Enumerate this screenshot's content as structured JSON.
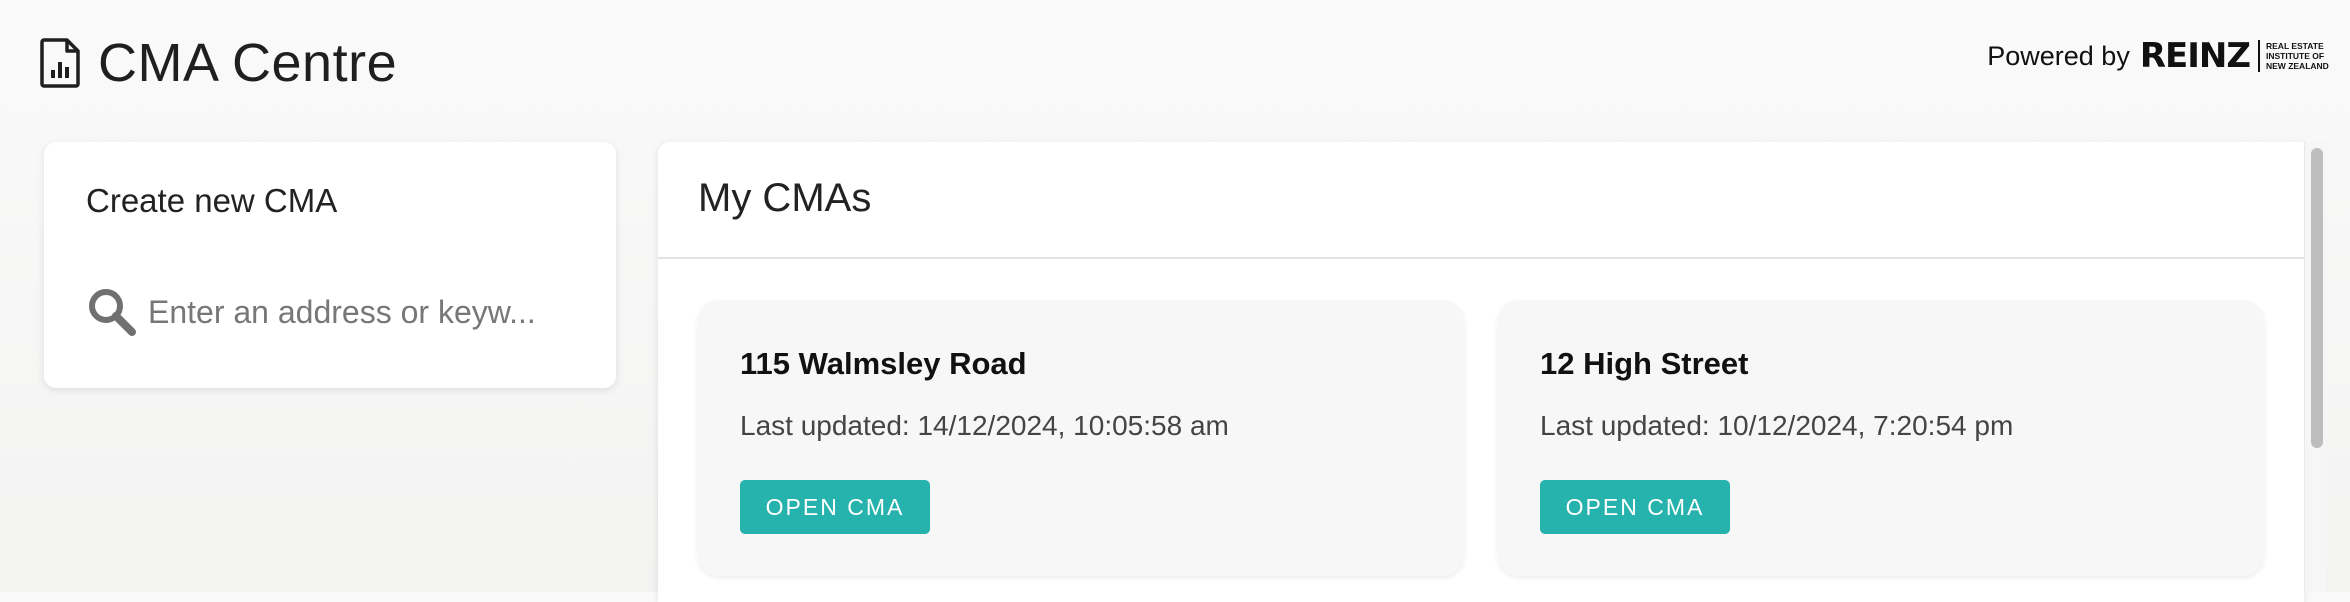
{
  "header": {
    "title": "CMA Centre",
    "icon": "document-chart-icon",
    "powered_by": "Powered by",
    "partner_logo": "REINZ",
    "partner_sub": [
      "REAL ESTATE",
      "INSTITUTE OF",
      "NEW ZEALAND"
    ]
  },
  "create": {
    "title": "Create new CMA",
    "search_placeholder": "Enter an address or keyw...",
    "search_value": "",
    "search_icon": "search-icon"
  },
  "my_cmas": {
    "title": "My CMAs",
    "items": [
      {
        "address": "115 Walmsley Road",
        "updated": "Last updated: 14/12/2024, 10:05:58 am",
        "button": "OPEN CMA"
      },
      {
        "address": "12 High Street",
        "updated": "Last updated: 10/12/2024, 7:20:54 pm",
        "button": "OPEN CMA"
      }
    ]
  },
  "colors": {
    "accent": "#26b3ad",
    "text": "#1c1c1c",
    "background": "#f6f6f5"
  }
}
